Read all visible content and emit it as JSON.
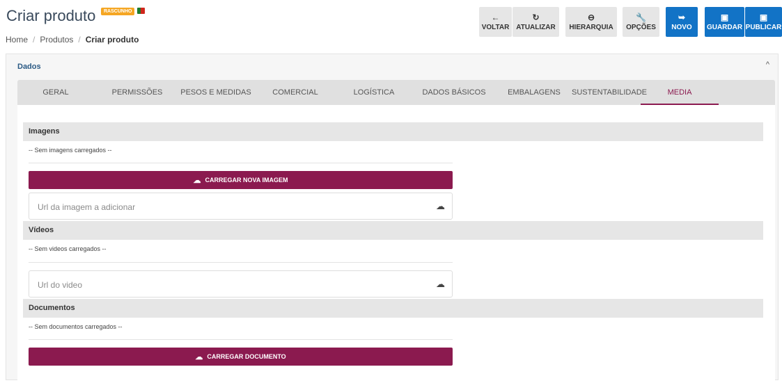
{
  "header": {
    "title": "Criar produto",
    "badge": "RASCUNHO",
    "breadcrumb": {
      "home": "Home",
      "sep": "/",
      "products": "Produtos",
      "current": "Criar produto"
    }
  },
  "toolbar": {
    "voltar": {
      "label": "VOLTAR",
      "icon": "←"
    },
    "atualizar": {
      "label": "ATUALIZAR",
      "icon": "↻"
    },
    "hierarquia": {
      "label": "HIERARQUIA",
      "icon": "⊖"
    },
    "opcoes": {
      "label": "OPÇÕES",
      "icon": "🔧"
    },
    "novo": {
      "label": "NOVO",
      "icon": "➥"
    },
    "guardar": {
      "label": "GUARDAR",
      "icon": "▣"
    },
    "publicar": {
      "label": "PUBLICAR",
      "icon": "▣"
    }
  },
  "panel": {
    "title": "Dados",
    "collapse_icon": "^",
    "tabs": [
      "GERAL",
      "PERMISSÕES",
      "PESOS E MEDIDAS",
      "COMERCIAL",
      "LOGÍSTICA",
      "DADOS BÁSICOS",
      "EMBALAGENS",
      "SUSTENTABILIDADE",
      "MEDIA"
    ],
    "active_tab": "MEDIA"
  },
  "media": {
    "images": {
      "header": "Imagens",
      "empty": "-- Sem imagens carregados --",
      "upload_label": "CARREGAR NOVA IMAGEM",
      "url_placeholder": "Url da imagem a adicionar"
    },
    "videos": {
      "header": "Vídeos",
      "empty": "-- Sem videos carregados --",
      "url_placeholder": "Url do video"
    },
    "documents": {
      "header": "Documentos",
      "empty": "-- Sem documentos carregados --",
      "upload_label": "CARREGAR DOCUMENTO"
    }
  },
  "colors": {
    "accent_purple": "#8b1a4f",
    "primary_blue": "#1273c6",
    "badge_orange": "#f5a623"
  }
}
